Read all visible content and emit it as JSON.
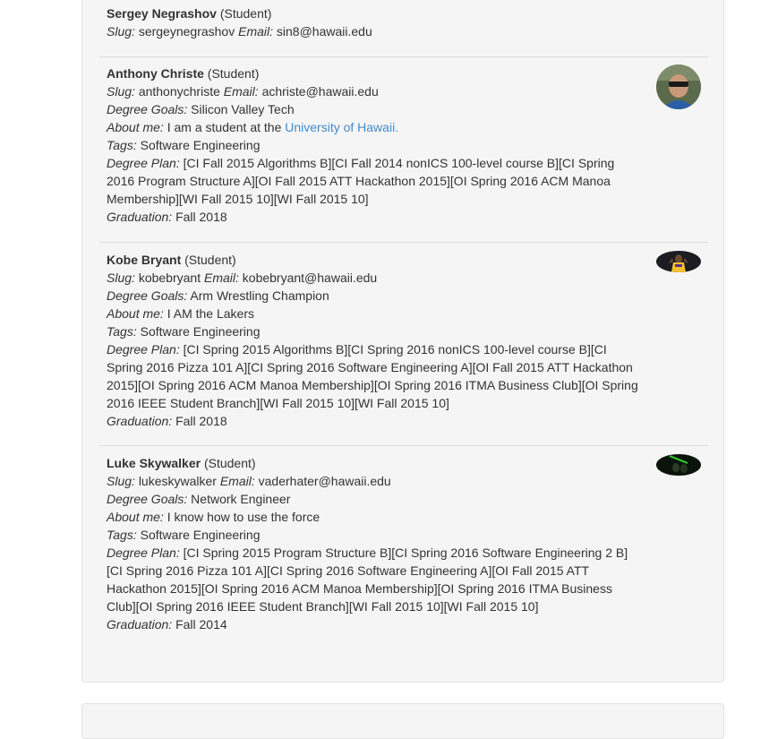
{
  "labels": {
    "slug": "Slug:",
    "email": "Email:",
    "goals": "Degree Goals:",
    "about": "About me:",
    "tags": "Tags:",
    "plan": "Degree Plan:",
    "grad": "Graduation:"
  },
  "students": [
    {
      "name": "Sergey Negrashov",
      "role": "(Student)",
      "slug": "sergeynegrashov",
      "email": "sin8@hawaii.edu"
    },
    {
      "name": "Anthony Christe",
      "role": "(Student)",
      "slug": "anthonychriste",
      "email": "achriste@hawaii.edu",
      "goals": "Silicon Valley Tech",
      "about_prefix": "I am a student at the",
      "about_link": "University of Hawaii.",
      "tags": "Software Engineering",
      "plan": "[CI Fall 2015 Algorithms B][CI Fall 2014 nonICS 100-level course B][CI Spring 2016 Program Structure A][OI Fall 2015 ATT Hackathon 2015][OI Spring 2016 ACM Manoa Membership][WI Fall 2015 10][WI Fall 2015 10]",
      "graduation": "Fall 2018",
      "avatar_icon": "person-photo-icon"
    },
    {
      "name": "Kobe Bryant",
      "role": "(Student)",
      "slug": "kobebryant",
      "email": "kobebryant@hawaii.edu",
      "goals": "Arm Wrestling Champion",
      "about": "I AM the Lakers",
      "tags": "Software Engineering",
      "plan": "[CI Spring 2015 Algorithms B][CI Spring 2016 nonICS 100-level course B][CI Spring 2016 Pizza 101 A][CI Spring 2016 Software Engineering A][OI Fall 2015 ATT Hackathon 2015][OI Spring 2016 ACM Manoa Membership][OI Spring 2016 ITMA Business Club][OI Spring 2016 IEEE Student Branch][WI Fall 2015 10][WI Fall 2015 10]",
      "graduation": "Fall 2018",
      "avatar_icon": "person-photo-icon"
    },
    {
      "name": "Luke Skywalker",
      "role": "(Student)",
      "slug": "lukeskywalker",
      "email": "vaderhater@hawaii.edu",
      "goals": "Network Engineer",
      "about": "I know how to use the force",
      "tags": "Software Engineering",
      "plan": "[CI Spring 2015 Program Structure B][CI Spring 2016 Software Engineering 2 B][CI Spring 2016 Pizza 101 A][CI Spring 2016 Software Engineering A][OI Fall 2015 ATT Hackathon 2015][OI Spring 2016 ACM Manoa Membership][OI Spring 2016 ITMA Business Club][OI Spring 2016 IEEE Student Branch][WI Fall 2015 10][WI Fall 2015 10]",
      "graduation": "Fall 2014",
      "avatar_icon": "person-photo-icon"
    }
  ],
  "colors": {
    "link": "#428bca",
    "panel_bg": "#f5f5f5",
    "separator": "#dddddd"
  }
}
